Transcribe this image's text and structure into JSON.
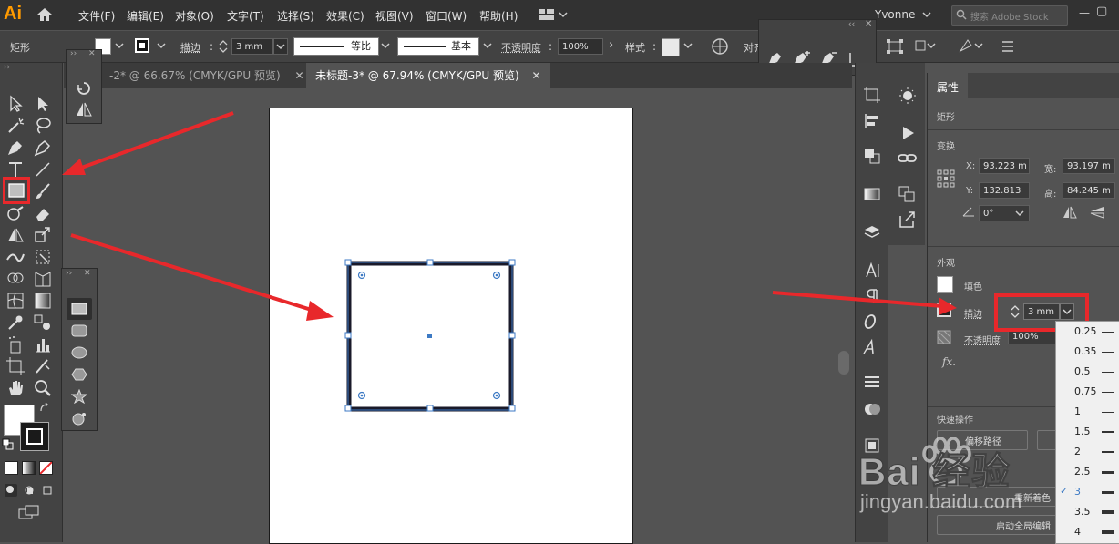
{
  "app": {
    "logo": "Ai",
    "user": "Yvonne",
    "search_placeholder": "搜索 Adobe Stock"
  },
  "menu": [
    "文件(F)",
    "编辑(E)",
    "对象(O)",
    "文字(T)",
    "选择(S)",
    "效果(C)",
    "视图(V)",
    "窗口(W)",
    "帮助(H)"
  ],
  "control": {
    "object_type": "矩形",
    "stroke_label": "描边",
    "stroke_value": "3 mm",
    "profile_equal": "等比",
    "brush_basic": "基本",
    "opacity_label": "不透明度",
    "opacity_value": "100%",
    "style_label": "样式",
    "align_label": "对齐"
  },
  "tabs": [
    {
      "label": "-2* @ 66.67% (CMYK/GPU 预览)"
    },
    {
      "label": "未标题-3* @ 67.94% (CMYK/GPU 预览)"
    }
  ],
  "properties": {
    "tab": "属性",
    "object_type": "矩形",
    "transform_title": "变换",
    "x_label": "X:",
    "x_value": "93.223 m",
    "y_label": "Y:",
    "y_value": "132.813",
    "w_label": "宽:",
    "w_value": "93.197 m",
    "h_label": "高:",
    "h_value": "84.245 m",
    "angle_value": "0°",
    "appearance_title": "外观",
    "fill_label": "填色",
    "stroke_label": "描边",
    "stroke_value": "3 mm",
    "opacity_label": "不透明度",
    "opacity_value": "100%",
    "fx_label": "fx.",
    "quick_actions_title": "快速操作",
    "btn_offset_path": "偏移路径",
    "btn_recolor": "重新着色",
    "btn_global_edit": "启动全局编辑"
  },
  "stroke_options": [
    {
      "value": "0.25",
      "selected": false
    },
    {
      "value": "0.35",
      "selected": false
    },
    {
      "value": "0.5",
      "selected": false
    },
    {
      "value": "0.75",
      "selected": false
    },
    {
      "value": "1",
      "selected": false
    },
    {
      "value": "1.5",
      "selected": false
    },
    {
      "value": "2",
      "selected": false
    },
    {
      "value": "2.5",
      "selected": false
    },
    {
      "value": "3",
      "selected": true
    },
    {
      "value": "3.5",
      "selected": false
    },
    {
      "value": "4",
      "selected": false
    }
  ],
  "watermark": {
    "brand": "Bai 经验",
    "url": "jingyan.baidu.com"
  },
  "colors": {
    "accent_red": "#e8282b",
    "app_orange": "#ff9a00",
    "selection_blue": "#3d7ac4"
  }
}
